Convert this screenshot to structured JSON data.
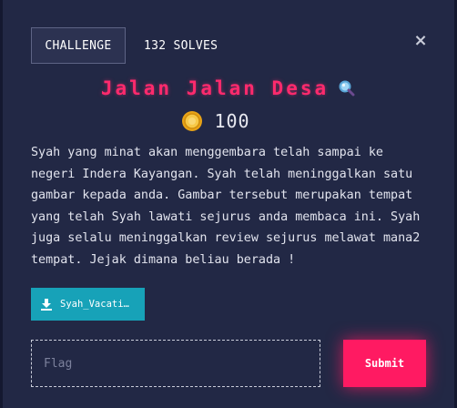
{
  "header": {
    "tab_challenge": "CHALLENGE",
    "tab_solves": "132 SOLVES",
    "close_glyph": "×"
  },
  "challenge": {
    "title": "Jalan Jalan Desa",
    "title_icon": "magnifier-icon",
    "points": "100",
    "points_icon": "coin-icon",
    "description": "Syah yang minat akan menggembara telah sampai ke\nnegeri Indera Kayangan. Syah telah meninggalkan satu\ngambar kepada anda. Gambar tersebut merupakan tempat\nyang telah Syah lawati sejurus anda membaca ini. Syah\njuga selalu meninggalkan review sejurus melawat mana2\ntempat. Jejak dimana beliau berada !"
  },
  "attachment": {
    "label": "Syah_Vacati…",
    "icon": "download-icon"
  },
  "form": {
    "flag_placeholder": "Flag",
    "flag_value": "",
    "submit_label": "Submit"
  },
  "colors": {
    "background": "#222845",
    "title": "#ff2a6d",
    "download_button": "#17a2b8",
    "submit_button": "#ff1a62"
  }
}
